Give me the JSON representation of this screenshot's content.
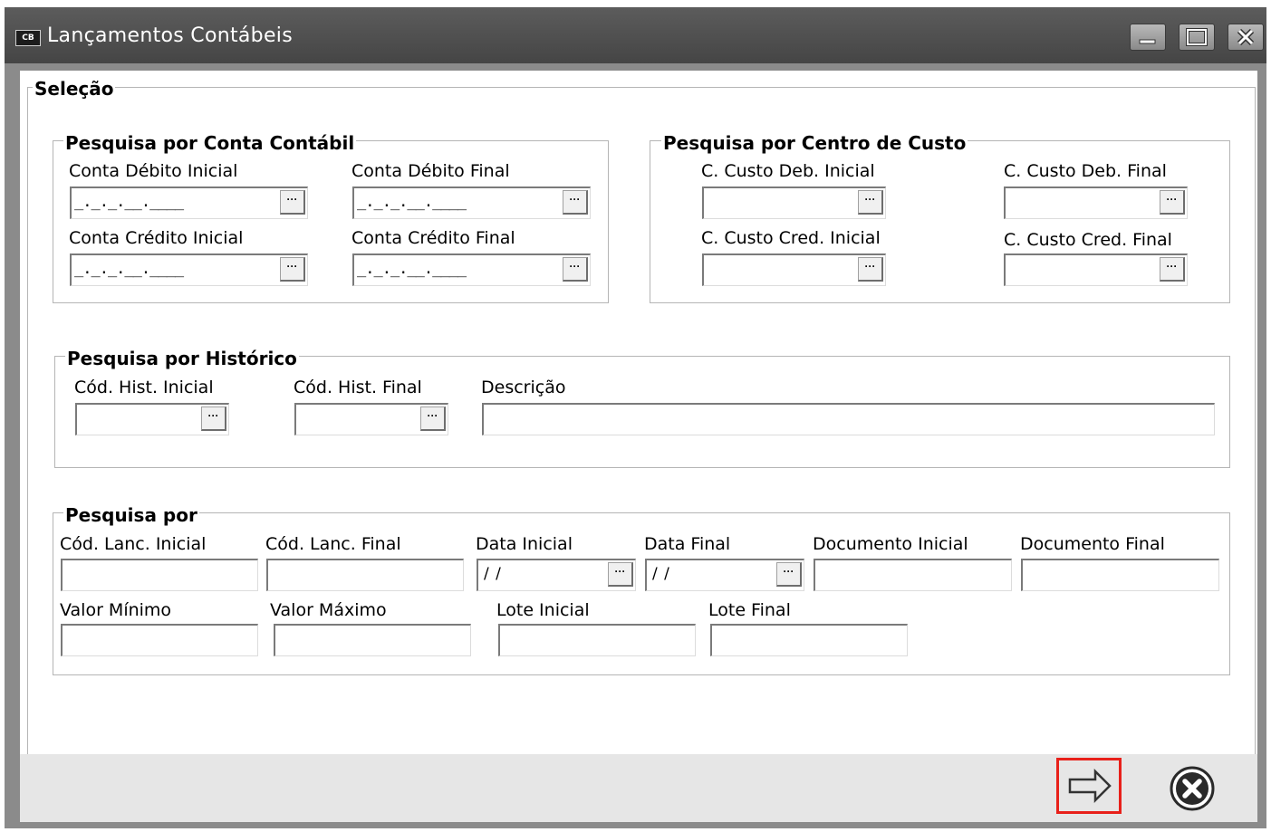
{
  "window": {
    "title": "Lançamentos Contábeis",
    "app_badge": "CB"
  },
  "selection": {
    "legend": "Seleção",
    "conta_contabil": {
      "legend": "Pesquisa por Conta Contábil",
      "debito_inicial_label": "Conta Débito Inicial",
      "debito_final_label": "Conta Débito Final",
      "credito_inicial_label": "Conta Crédito Inicial",
      "credito_final_label": "Conta Crédito Final",
      "mask": "_._._.__.____"
    },
    "centro_custo": {
      "legend": "Pesquisa por Centro de Custo",
      "deb_inicial_label": "C. Custo Deb. Inicial",
      "deb_final_label": "C. Custo Deb. Final",
      "cred_inicial_label": "C. Custo Cred. Inicial",
      "cred_final_label": "C. Custo Cred. Final"
    },
    "historico": {
      "legend": "Pesquisa por Histórico",
      "hist_inicial_label": "Cód. Hist. Inicial",
      "hist_final_label": "Cód. Hist. Final",
      "descricao_label": "Descrição"
    },
    "pesquisa_por": {
      "legend": "Pesquisa por",
      "lanc_inicial_label": "Cód. Lanc. Inicial",
      "lanc_final_label": "Cód. Lanc. Final",
      "data_inicial_label": "Data Inicial",
      "data_final_label": "Data Final",
      "doc_inicial_label": "Documento Inicial",
      "doc_final_label": "Documento Final",
      "valor_minimo_label": "Valor Mínimo",
      "valor_maximo_label": "Valor Máximo",
      "lote_inicial_label": "Lote Inicial",
      "lote_final_label": "Lote Final",
      "date_mask": "/ /"
    }
  },
  "lookup_glyph": "···",
  "colors": {
    "titlebar": "#4f4f4f",
    "highlight": "#e8201a"
  }
}
